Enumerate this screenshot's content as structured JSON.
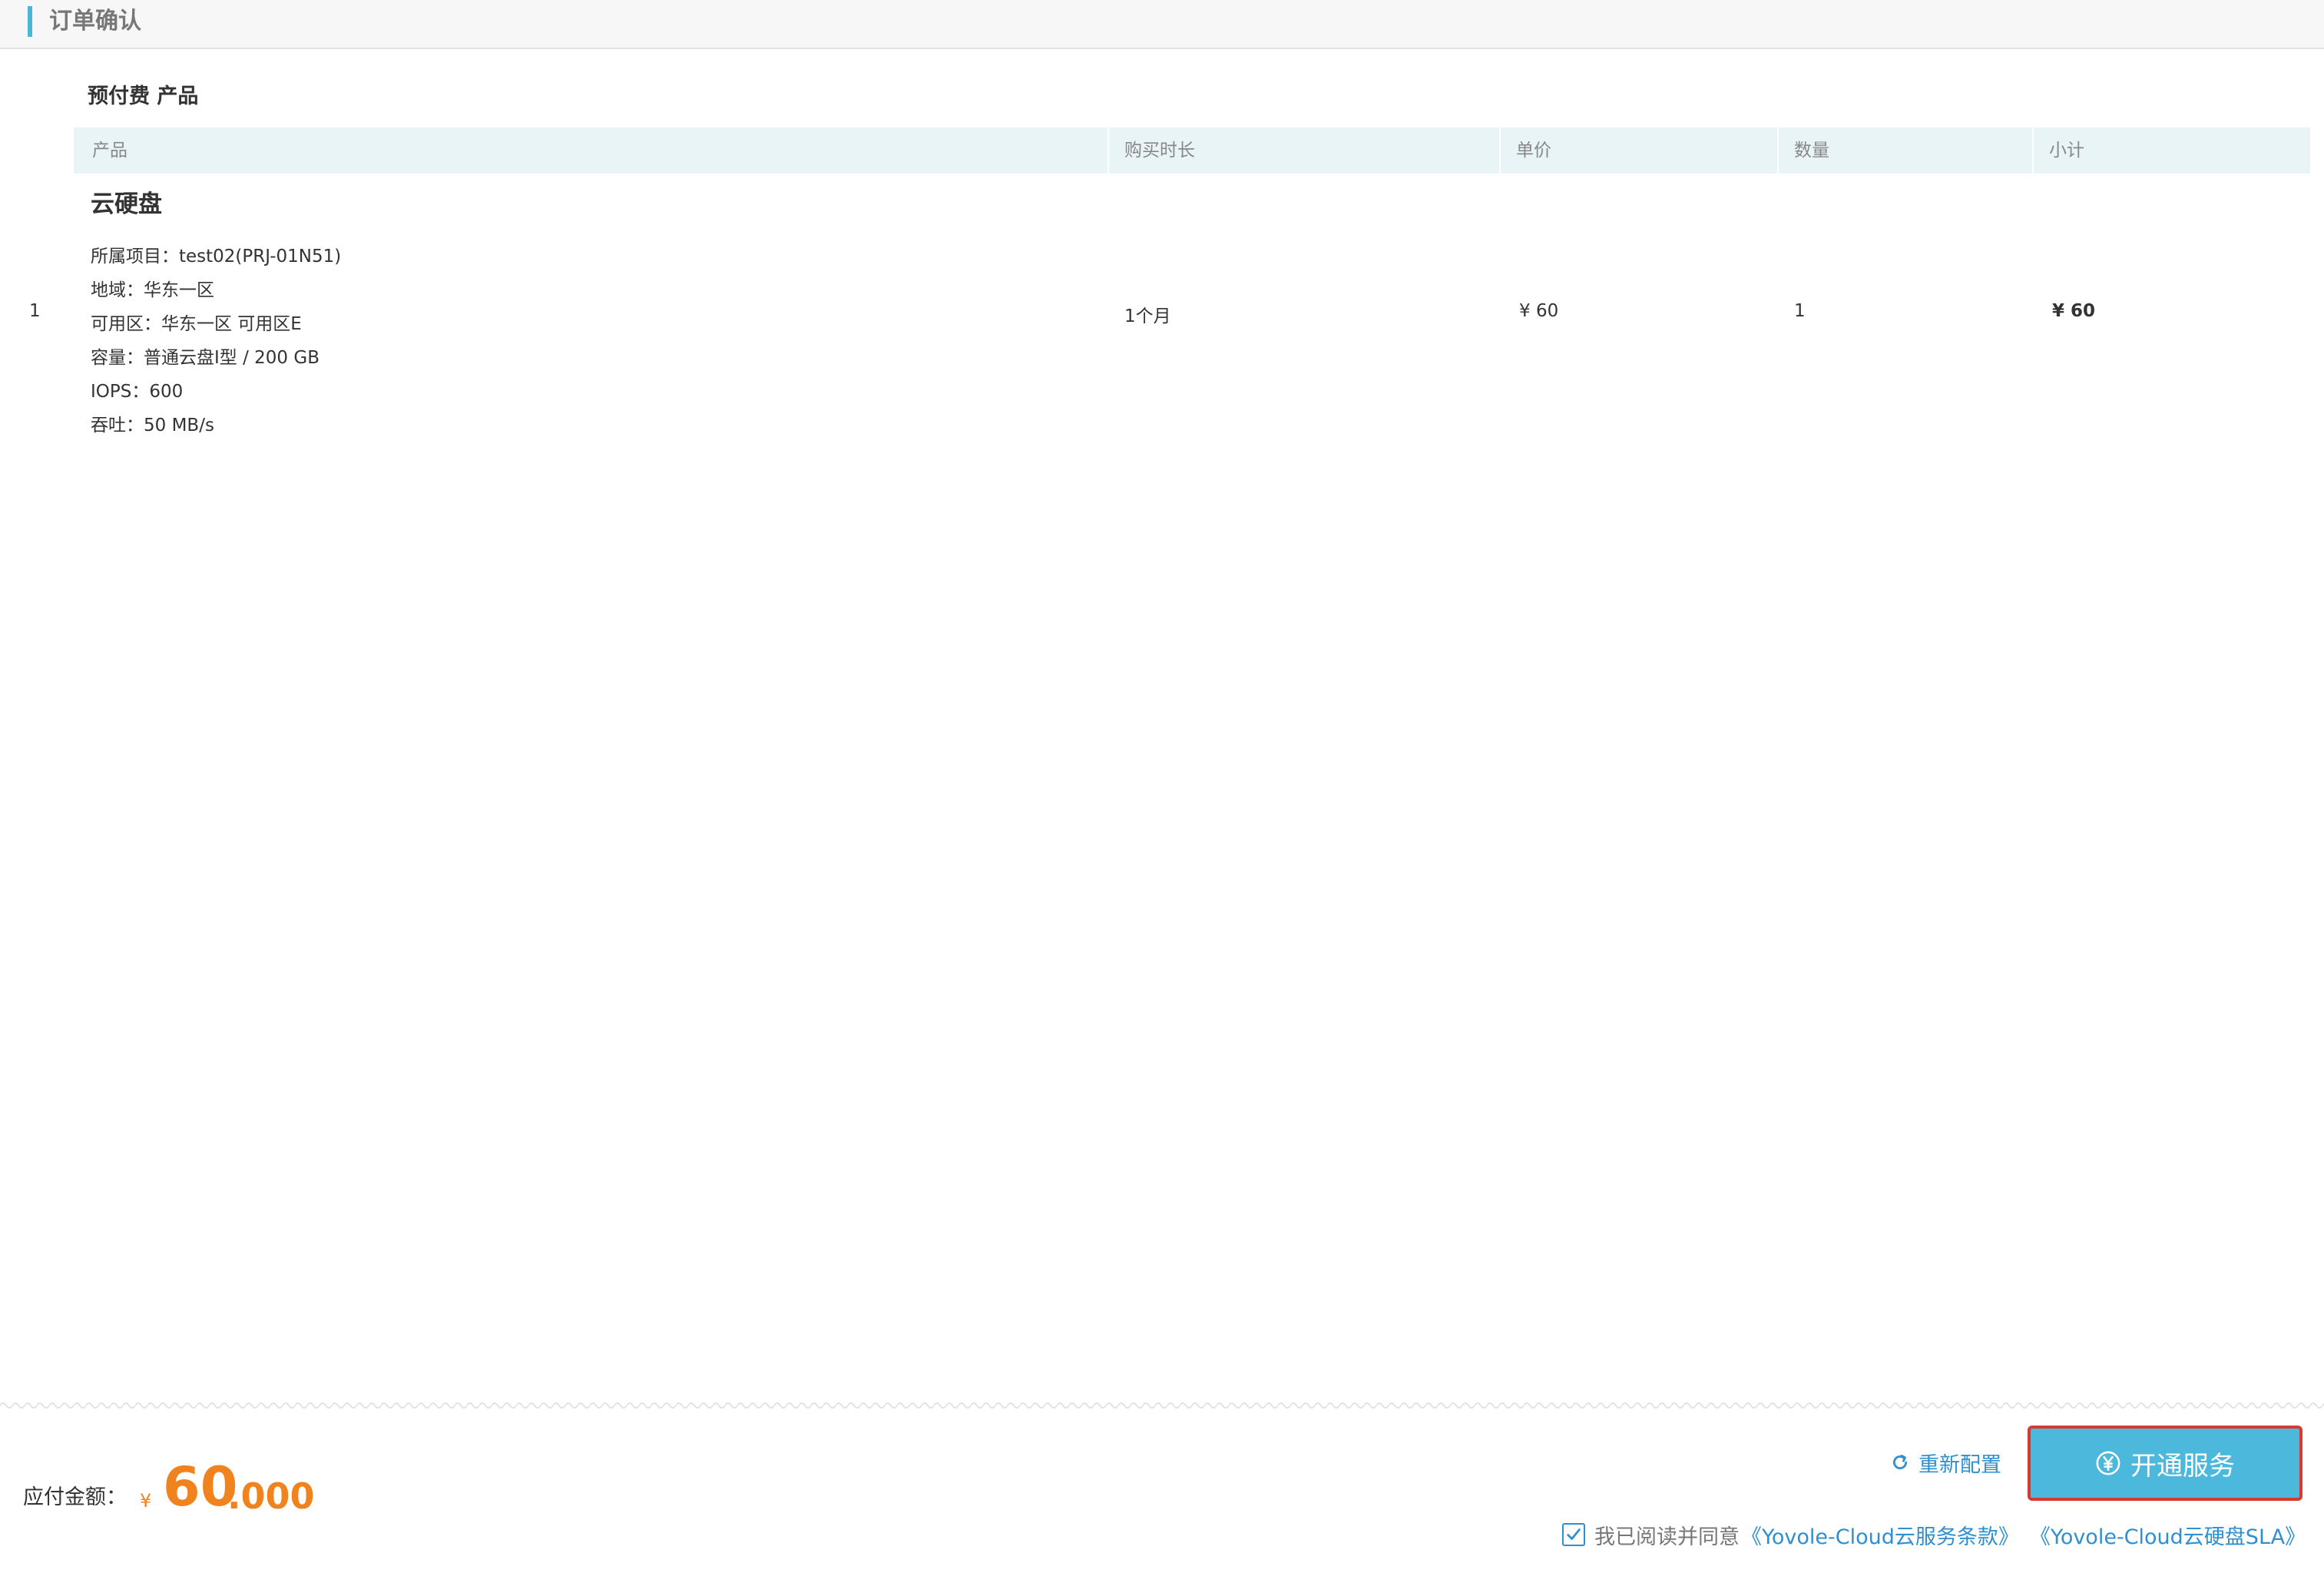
{
  "header": {
    "title": "订单确认"
  },
  "section": {
    "title": "预付费 产品"
  },
  "table": {
    "columns": [
      "产品",
      "购买时长",
      "单价",
      "数量",
      "小计"
    ],
    "row": {
      "index": "1",
      "product_name": "云硬盘",
      "details": [
        "所属项目：test02(PRJ-01N51)",
        "地域：华东一区",
        "可用区：华东一区 可用区E",
        "容量：普通云盘I型 / 200 GB",
        "IOPS：600",
        "吞吐：50 MB/s"
      ],
      "duration": "1个月",
      "unit_price": "¥ 60",
      "quantity": "1",
      "subtotal": "¥ 60"
    }
  },
  "footer": {
    "amount_label": "应付金额：",
    "currency": "¥",
    "amount_integer": "60",
    "amount_decimal": ".000",
    "reconfigure_label": "重新配置",
    "open_service_label": "开通服务",
    "agree_text": "我已阅读并同意",
    "terms_link": "《Yovole-Cloud云服务条款》",
    "sla_link": "《Yovole-Cloud云硬盘SLA》",
    "agree_checked": true
  },
  "colors": {
    "accent": "#4bb8dc",
    "link": "#2f8fd0",
    "price": "#f0831e",
    "highlight_border": "#d93a2f",
    "table_header_bg": "#e9f4f6"
  },
  "icons": {
    "reconfigure": "refresh-icon",
    "open_service": "yen-circle-icon",
    "agree": "checkbox-checked-icon"
  }
}
